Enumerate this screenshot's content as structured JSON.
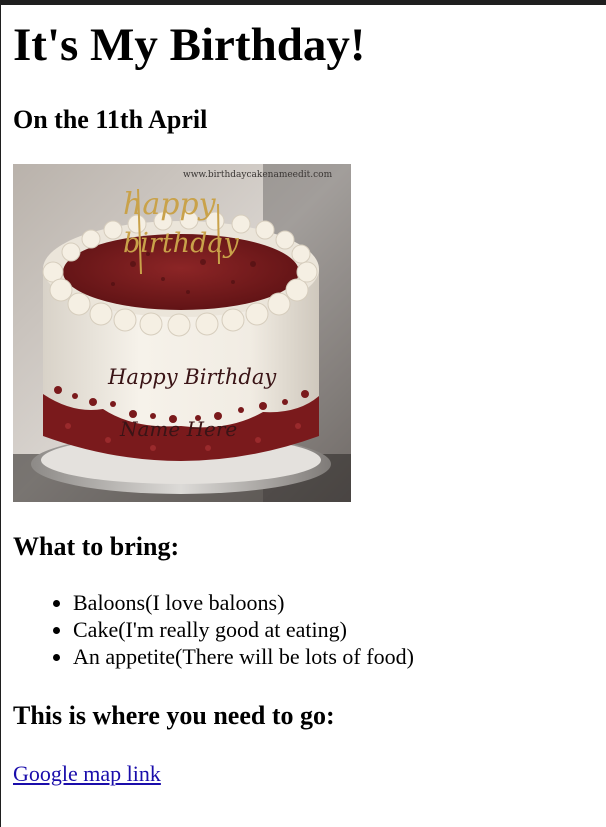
{
  "page": {
    "title": "It's My Birthday!",
    "date": "On the 11th April"
  },
  "image": {
    "watermark": "www.birthdaycakenameedit.com",
    "topper_text_1": "happy",
    "topper_text_2": "birthday",
    "cake_text_1": "Happy Birthday",
    "cake_text_2": "Name Here"
  },
  "bring": {
    "heading": "What to bring:",
    "items": [
      "Baloons(I love baloons)",
      "Cake(I'm really good at eating)",
      "An appetite(There will be lots of food)"
    ]
  },
  "location": {
    "heading": "This is where you need to go:",
    "link_text": "Google map link"
  },
  "colors": {
    "link": "#1a0dab",
    "frame": "#1f1f1f",
    "frosting": "#f2ede4",
    "red_velvet": "#7a1a1c",
    "topper_gold": "#c9a24a",
    "icing_text": "#3a1416"
  }
}
